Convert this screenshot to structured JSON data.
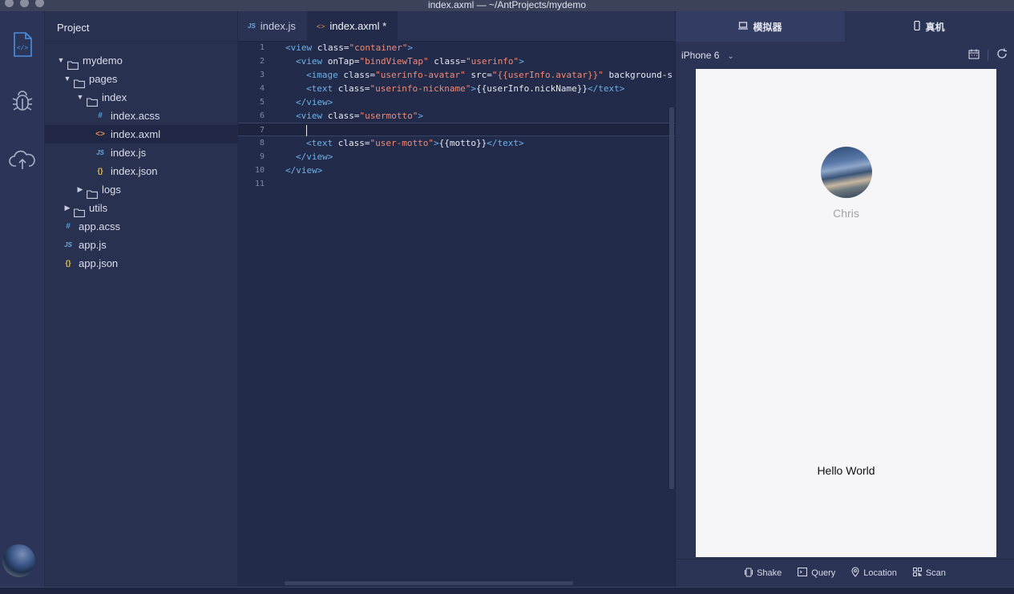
{
  "window": {
    "title": "index.axml — ~/AntProjects/mydemo"
  },
  "activity": {
    "items": [
      "code-file-icon",
      "bug-icon",
      "cloud-upload-icon"
    ],
    "accent": "#4b8fe0"
  },
  "sidebar": {
    "header": "Project",
    "tree": [
      {
        "label": "mydemo",
        "type": "folder",
        "expanded": true,
        "depth": 0
      },
      {
        "label": "pages",
        "type": "folder",
        "expanded": true,
        "depth": 1
      },
      {
        "label": "index",
        "type": "folder",
        "expanded": true,
        "depth": 2
      },
      {
        "label": "index.acss",
        "type": "acss",
        "depth": 3,
        "icon": "#"
      },
      {
        "label": "index.axml",
        "type": "axml",
        "depth": 3,
        "icon": "<>",
        "active": true
      },
      {
        "label": "index.js",
        "type": "js",
        "depth": 3,
        "icon": "JS"
      },
      {
        "label": "index.json",
        "type": "json",
        "depth": 3,
        "icon": "{}"
      },
      {
        "label": "logs",
        "type": "folder",
        "expanded": false,
        "depth": 2
      },
      {
        "label": "utils",
        "type": "folder",
        "expanded": false,
        "depth": 1
      },
      {
        "label": "app.acss",
        "type": "acss",
        "depth": 1,
        "icon": "#"
      },
      {
        "label": "app.js",
        "type": "js",
        "depth": 1,
        "icon": "JS"
      },
      {
        "label": "app.json",
        "type": "json",
        "depth": 1,
        "icon": "{}"
      }
    ]
  },
  "editor": {
    "tabs": [
      {
        "label": "index.js",
        "icon": "JS",
        "active": false
      },
      {
        "label": "index.axml *",
        "icon": "<>",
        "active": true
      }
    ],
    "lines": [
      {
        "n": "1",
        "indent": 0,
        "parts": [
          [
            "tg",
            "<view "
          ],
          [
            "at",
            "class="
          ],
          [
            "st",
            "\"container\""
          ],
          [
            "tg",
            ">"
          ]
        ]
      },
      {
        "n": "2",
        "indent": 1,
        "parts": [
          [
            "tg",
            "<view "
          ],
          [
            "at",
            "onTap="
          ],
          [
            "st",
            "\"bindViewTap\""
          ],
          [
            "at",
            " class="
          ],
          [
            "st",
            "\"userinfo\""
          ],
          [
            "tg",
            ">"
          ]
        ]
      },
      {
        "n": "3",
        "indent": 2,
        "parts": [
          [
            "tg",
            "<image "
          ],
          [
            "at",
            "class="
          ],
          [
            "st",
            "\"userinfo-avatar\""
          ],
          [
            "at",
            " src="
          ],
          [
            "st",
            "\"{{userInfo.avatar}}\""
          ],
          [
            "at",
            " background-s"
          ]
        ]
      },
      {
        "n": "4",
        "indent": 2,
        "parts": [
          [
            "tg",
            "<text "
          ],
          [
            "at",
            "class="
          ],
          [
            "st",
            "\"userinfo-nickname\""
          ],
          [
            "tg",
            ">"
          ],
          [
            "tx2",
            "{{userInfo.nickName}}"
          ],
          [
            "tg",
            "</text>"
          ]
        ]
      },
      {
        "n": "5",
        "indent": 1,
        "parts": [
          [
            "tg",
            "</view>"
          ]
        ]
      },
      {
        "n": "6",
        "indent": 1,
        "parts": [
          [
            "tg",
            "<view "
          ],
          [
            "at",
            "class="
          ],
          [
            "st",
            "\"usermotto\""
          ],
          [
            "tg",
            ">"
          ]
        ]
      },
      {
        "n": "7",
        "indent": 2,
        "parts": [],
        "current": true
      },
      {
        "n": "8",
        "indent": 2,
        "parts": [
          [
            "tg",
            "<text "
          ],
          [
            "at",
            "class="
          ],
          [
            "st",
            "\"user-motto\""
          ],
          [
            "tg",
            ">"
          ],
          [
            "tx2",
            "{{motto}}"
          ],
          [
            "tg",
            "</text>"
          ]
        ]
      },
      {
        "n": "9",
        "indent": 1,
        "parts": [
          [
            "tg",
            "</view>"
          ]
        ]
      },
      {
        "n": "10",
        "indent": 0,
        "parts": [
          [
            "tg",
            "</view>"
          ]
        ]
      },
      {
        "n": "11",
        "indent": 0,
        "parts": []
      }
    ]
  },
  "simulator": {
    "tabs": [
      {
        "label": "模拟器",
        "icon": "laptop-icon",
        "active": true
      },
      {
        "label": "真机",
        "icon": "phone-icon",
        "active": false
      }
    ],
    "device": "iPhone 6",
    "phone": {
      "nickname": "Chris",
      "motto": "Hello World"
    },
    "footer": [
      {
        "label": "Shake",
        "icon": "shake-icon"
      },
      {
        "label": "Query",
        "icon": "terminal-icon"
      },
      {
        "label": "Location",
        "icon": "location-icon"
      },
      {
        "label": "Scan",
        "icon": "scan-icon"
      }
    ]
  }
}
